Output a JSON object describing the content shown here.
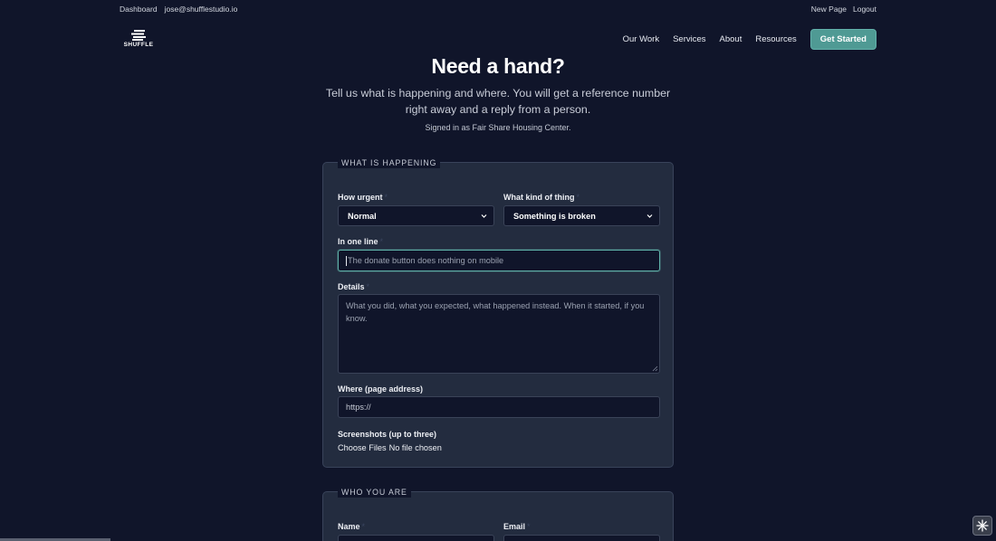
{
  "adminbar": {
    "dashboard": "Dashboard",
    "email": "jose@shufflestudio.io",
    "new_page": "New Page",
    "logout": "Logout"
  },
  "header": {
    "logo_text": "SHUFFLE",
    "nav": [
      "Our Work",
      "Services",
      "About",
      "Resources"
    ],
    "cta": "Get Started"
  },
  "hero": {
    "title": "Need a hand?",
    "subtitle": "Tell us what is happening and where. You will get a reference number right away and a reply from a person.",
    "signed_in": "Signed in as Fair Share Housing Center."
  },
  "section1": {
    "legend": "WHAT IS HAPPENING",
    "urgency_label": "How urgent",
    "urgency_value": "Normal",
    "kind_label": "What kind of thing",
    "kind_value": "Something is broken",
    "oneline_label": "In one line",
    "oneline_placeholder": "The donate button does nothing on mobile",
    "details_label": "Details",
    "details_placeholder": "What you did, what you expected, what happened instead. When it started, if you know.",
    "where_label": "Where (page address)",
    "where_placeholder": "https://",
    "screenshots_label": "Screenshots (up to three)",
    "choose_files": "Choose Files",
    "no_file": "No file chosen",
    "required_mark": "*"
  },
  "section2": {
    "legend": "WHO YOU ARE",
    "name_label": "Name",
    "email_label": "Email"
  },
  "colors": {
    "background": "#10152a",
    "card": "#232c3f",
    "accent": "#4f9a94",
    "focus": "#5fb0a8"
  }
}
